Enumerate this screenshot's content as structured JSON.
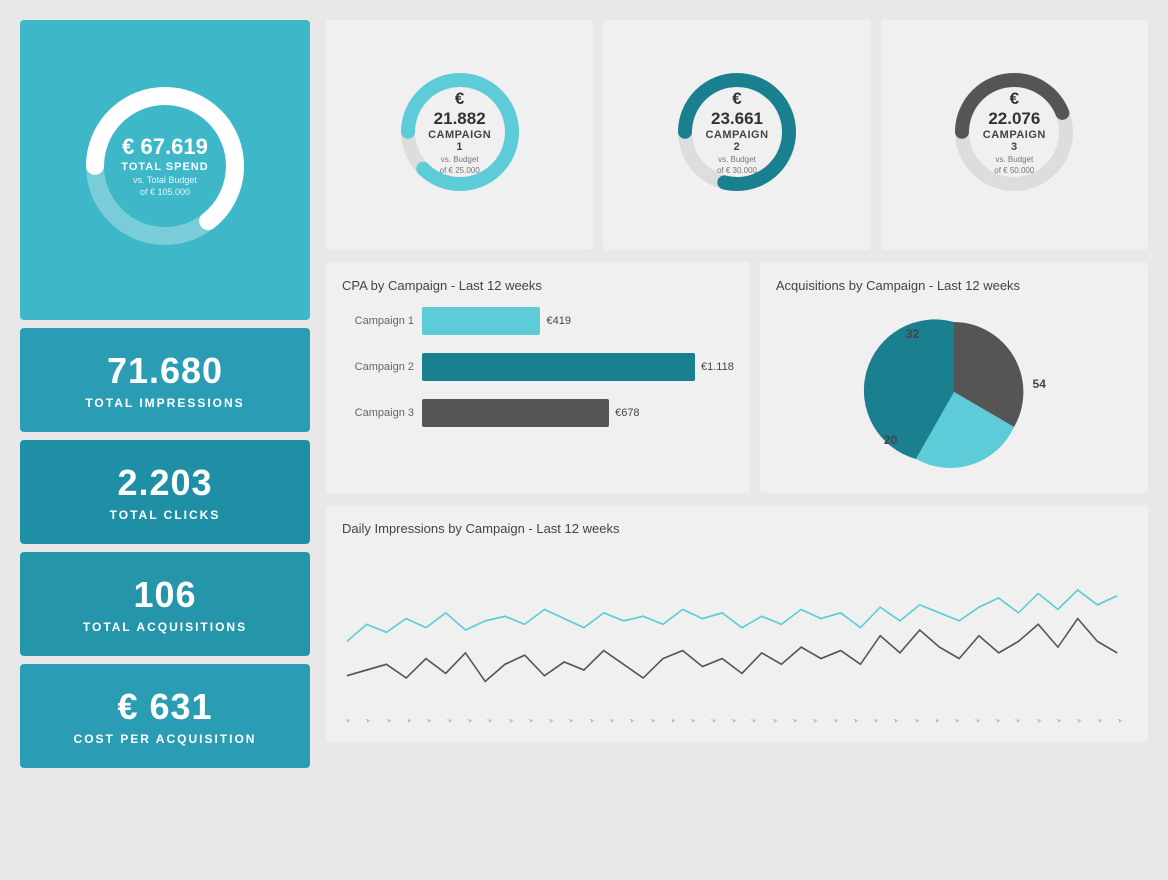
{
  "left": {
    "total_spend": {
      "amount": "€ 67.619",
      "label": "TOTAL SPEND",
      "sub1": "vs. Total Budget",
      "sub2": "of € 105.000",
      "value": 67619,
      "total": 105000
    },
    "impressions": {
      "number": "71.680",
      "label": "TOTAL IMPRESSIONS"
    },
    "clicks": {
      "number": "2.203",
      "label": "TOTAL CLICKS"
    },
    "acquisitions": {
      "number": "106",
      "label": "TOTAL ACQUISITIONS"
    },
    "cpa": {
      "number": "€ 631",
      "label": "COST PER ACQUISITION"
    }
  },
  "campaigns": [
    {
      "amount": "€ 21.882",
      "name": "CAMPAIGN 1",
      "sub1": "vs. Budget",
      "sub2": "of € 25.000",
      "value": 21882,
      "total": 25000,
      "color": "#5dccd8"
    },
    {
      "amount": "€ 23.661",
      "name": "CAMPAIGN 2",
      "sub1": "vs. Budget",
      "sub2": "of € 30.000",
      "value": 23661,
      "total": 30000,
      "color": "#1a7f8e"
    },
    {
      "amount": "€ 22.076",
      "name": "CAMPAIGN 3",
      "sub1": "vs. Budget",
      "sub2": "of € 50.000",
      "value": 22076,
      "total": 50000,
      "color": "#555555"
    }
  ],
  "cpa_chart": {
    "title": "CPA by Campaign - Last 12 weeks",
    "bars": [
      {
        "label": "Campaign 1",
        "value": "€419",
        "pct": 38,
        "color": "#5dccd8"
      },
      {
        "label": "Campaign 2",
        "value": "€1.118",
        "pct": 100,
        "color": "#1a7f8e"
      },
      {
        "label": "Campaign 3",
        "value": "€678",
        "pct": 60,
        "color": "#555555"
      }
    ]
  },
  "acquisitions_chart": {
    "title": "Acquisitions by Campaign - Last 12 weeks",
    "segments": [
      {
        "label": "32",
        "value": 32,
        "color": "#555555"
      },
      {
        "label": "54",
        "value": 54,
        "color": "#5dccd8"
      },
      {
        "label": "20",
        "value": 20,
        "color": "#1a7f8e"
      }
    ]
  },
  "impressions_chart": {
    "title": "Daily Impressions by Campaign - Last 12 weeks",
    "dates": [
      "2016.01.27",
      "2016.01.23",
      "2016.01.25",
      "2016.01.27",
      "2016.01.29",
      "2016.01.31",
      "2016.02.04",
      "2016.02.06",
      "2016.02.08",
      "2016.02.10",
      "2016.02.12",
      "2016.02.14",
      "2016.02.16",
      "2016.02.18",
      "2016.02.20",
      "2016.02.22",
      "2016.02.24",
      "2016.02.26",
      "2016.02.28",
      "2016.03.01",
      "2016.03.03",
      "2016.03.05",
      "2016.03.07",
      "2016.03.09",
      "2016.03.11",
      "2016.03.13",
      "2016.03.15",
      "2016.03.17",
      "2016.03.19",
      "2016.03.21",
      "2016.03.23",
      "2016.03.25",
      "2016.03.27",
      "2016.03.29",
      "2016.03.31",
      "2016.04.02",
      "2016.04.04",
      "2016.04.06",
      "2016.04.08",
      "2016.04.10",
      "2016.04.12"
    ]
  }
}
